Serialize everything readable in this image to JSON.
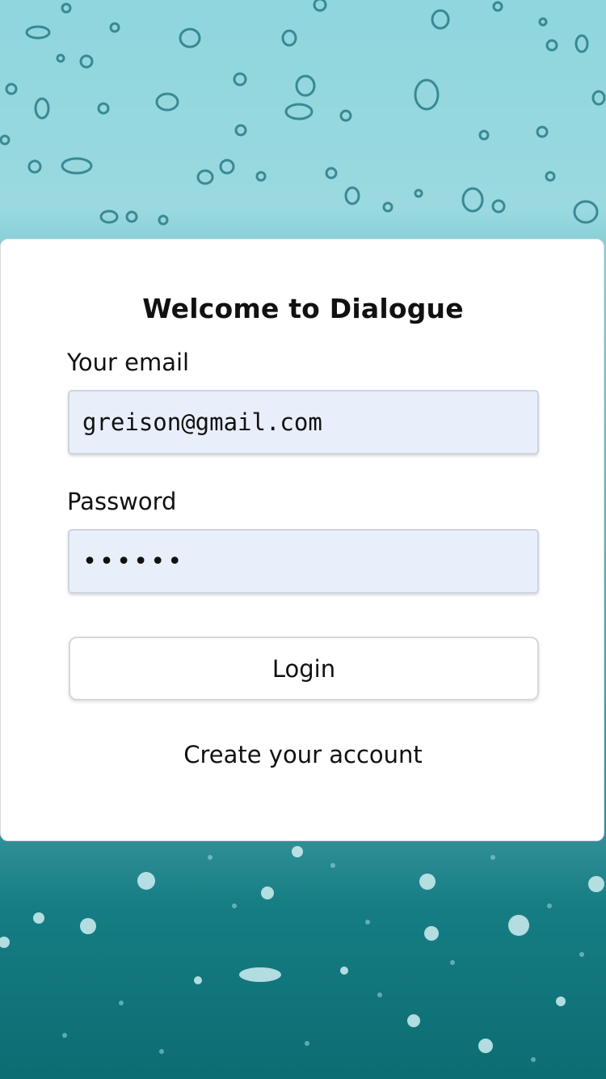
{
  "login_card": {
    "title": "Welcome to Dialogue",
    "email_label": "Your email",
    "email_value": "greison@gmail.com",
    "password_label": "Password",
    "password_value": "••••••",
    "login_button": "Login",
    "create_account_link": "Create your account"
  },
  "theme": {
    "background_top": "#8fd6de",
    "background_bottom": "#0c6d72",
    "card_background": "#ffffff",
    "input_background": "#e8effb"
  }
}
